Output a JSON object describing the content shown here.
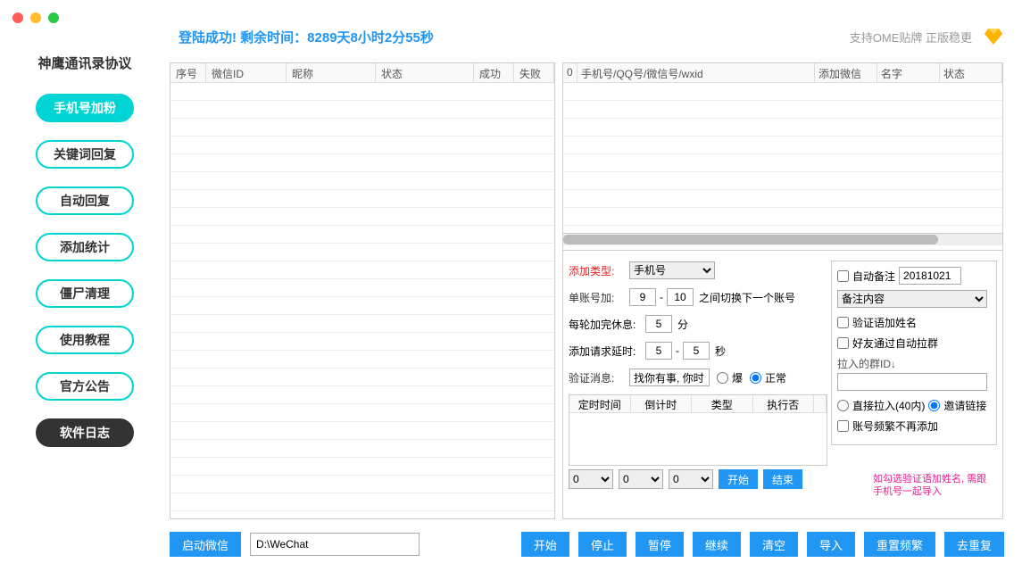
{
  "window": {
    "loginStatus": "登陆成功! 剩余时间：8289天8小时2分55秒",
    "topRight": "支持OME贴牌 正版稳更"
  },
  "sidebar": {
    "title": "神鹰通讯录协议",
    "items": [
      {
        "label": "手机号加粉",
        "active": true
      },
      {
        "label": "关键词回复",
        "active": false
      },
      {
        "label": "自动回复",
        "active": false
      },
      {
        "label": "添加统计",
        "active": false
      },
      {
        "label": "僵尸清理",
        "active": false
      },
      {
        "label": "使用教程",
        "active": false
      },
      {
        "label": "官方公告",
        "active": false
      },
      {
        "label": "软件日志",
        "active": false,
        "dark": true
      }
    ]
  },
  "mainTable": {
    "headers": [
      "序号",
      "微信ID",
      "昵称",
      "状态",
      "成功",
      "失败"
    ]
  },
  "rightTable": {
    "headers": [
      "0",
      "手机号/QQ号/微信号/wxid",
      "添加微信",
      "名字",
      "状态"
    ]
  },
  "config": {
    "addTypeLabel": "添加类型:",
    "addTypeValue": "手机号",
    "singleAccLabel": "单账号加:",
    "singleAccFrom": "9",
    "singleAccTo": "10",
    "singleAccSuffix": "之间切换下一个账号",
    "restLabel": "每轮加完休息:",
    "restValue": "5",
    "restUnit": "分",
    "delayLabel": "添加请求延时:",
    "delayFrom": "5",
    "delayTo": "5",
    "delayUnit": "秒",
    "verifyLabel": "验证消息:",
    "verifyValue": "找你有事, 你时",
    "radioBao": "爆",
    "radioNormal": "正常",
    "autoRemarkLabel": "自动备注",
    "autoRemarkValue": "20181021",
    "remarkContentPlaceholder": "备注内容",
    "verifyNameLabel": "验证语加姓名",
    "autoGroupLabel": "好友通过自动拉群",
    "groupIdLabel": "拉入的群ID↓",
    "directPullLabel": "直接拉入(40内)",
    "inviteLinkLabel": "邀请链接",
    "freqNoAddLabel": "账号频繁不再添加"
  },
  "timerTable": {
    "headers": [
      "定时时间",
      "倒计时",
      "类型",
      "执行否",
      ""
    ]
  },
  "timerControls": {
    "h": "0",
    "m": "0",
    "s": "0",
    "startBtn": "开始",
    "endBtn": "结束"
  },
  "hint": "如勾选验证语加姓名,\n需跟手机号一起导入",
  "bottomBar": {
    "startWx": "启动微信",
    "path": "D:\\WeChat",
    "start": "开始",
    "stop": "停止",
    "pause": "暂停",
    "resume": "继续",
    "clear": "清空",
    "import": "导入",
    "resetFreq": "重置频繁",
    "dedup": "去重复"
  }
}
